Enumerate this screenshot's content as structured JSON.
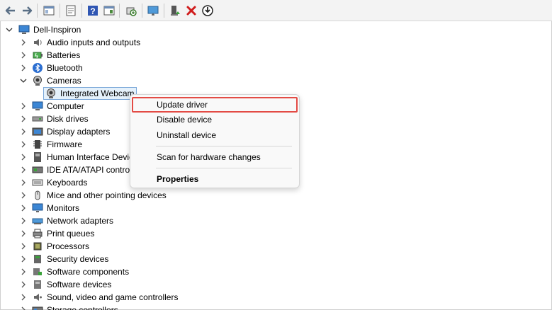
{
  "toolbar": {
    "buttons": [
      {
        "name": "back-arrow-icon"
      },
      {
        "name": "forward-arrow-icon"
      },
      {
        "name": "show-hide-console-tree-icon"
      },
      {
        "name": "properties-sheet-icon"
      },
      {
        "name": "help-icon"
      },
      {
        "name": "action-pane-icon"
      },
      {
        "name": "scan-hardware-icon"
      },
      {
        "name": "monitor-icon"
      },
      {
        "name": "enable-device-icon"
      },
      {
        "name": "uninstall-device-icon"
      },
      {
        "name": "update-driver-icon"
      }
    ]
  },
  "tree": {
    "root": "Dell-Inspiron",
    "items": [
      {
        "label": "Audio inputs and outputs",
        "icon": "speaker-icon",
        "expanded": false
      },
      {
        "label": "Batteries",
        "icon": "battery-icon",
        "expanded": false
      },
      {
        "label": "Bluetooth",
        "icon": "bluetooth-icon",
        "expanded": false
      },
      {
        "label": "Cameras",
        "icon": "camera-icon",
        "expanded": true
      },
      {
        "label": "Computer",
        "icon": "computer-icon",
        "expanded": false
      },
      {
        "label": "Disk drives",
        "icon": "disk-drive-icon",
        "expanded": false
      },
      {
        "label": "Display adapters",
        "icon": "display-adapter-icon",
        "expanded": false
      },
      {
        "label": "Firmware",
        "icon": "firmware-icon",
        "expanded": false
      },
      {
        "label": "Human Interface Devic",
        "icon": "hid-icon",
        "expanded": false
      },
      {
        "label": "IDE ATA/ATAPI control",
        "icon": "ide-controller-icon",
        "expanded": false
      },
      {
        "label": "Keyboards",
        "icon": "keyboard-icon",
        "expanded": false
      },
      {
        "label": "Mice and other pointing devices",
        "icon": "mouse-icon",
        "expanded": false
      },
      {
        "label": "Monitors",
        "icon": "monitor-icon",
        "expanded": false
      },
      {
        "label": "Network adapters",
        "icon": "network-adapter-icon",
        "expanded": false
      },
      {
        "label": "Print queues",
        "icon": "printer-icon",
        "expanded": false
      },
      {
        "label": "Processors",
        "icon": "processor-icon",
        "expanded": false
      },
      {
        "label": "Security devices",
        "icon": "security-device-icon",
        "expanded": false
      },
      {
        "label": "Software components",
        "icon": "software-component-icon",
        "expanded": false
      },
      {
        "label": "Software devices",
        "icon": "software-device-icon",
        "expanded": false
      },
      {
        "label": "Sound, video and game controllers",
        "icon": "sound-controller-icon",
        "expanded": false
      },
      {
        "label": "Storage controllers",
        "icon": "storage-controller-icon",
        "expanded": false
      }
    ],
    "camera_child": "Integrated Webcam"
  },
  "context_menu": {
    "update_driver": "Update driver",
    "disable_device": "Disable device",
    "uninstall_device": "Uninstall device",
    "scan_hardware": "Scan for hardware changes",
    "properties": "Properties"
  },
  "colors": {
    "highlight_border": "#e34b45",
    "selection_bg": "#e5f1fb",
    "selection_border": "#7aa7d9"
  }
}
